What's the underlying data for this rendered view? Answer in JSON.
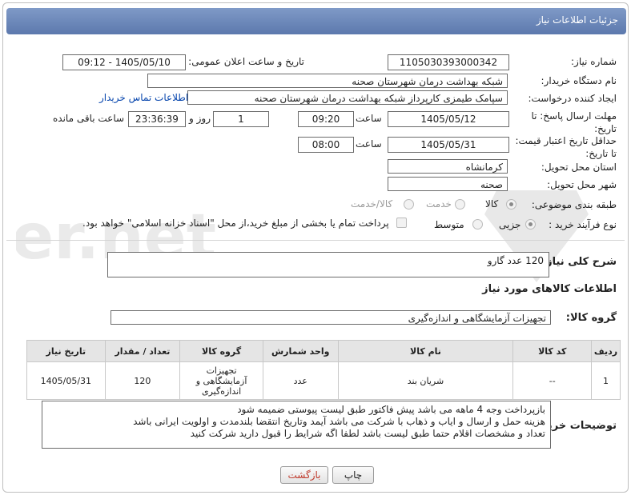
{
  "header": {
    "title": "جزئیات اطلاعات نیاز"
  },
  "form": {
    "need_number_label": "شماره نیاز:",
    "need_number": "1105030393000342",
    "announce_label": "تاریخ و ساعت اعلان عمومی:",
    "announce_value": "1405/05/10 - 09:12",
    "buyer_org_label": "نام دستگاه خریدار:",
    "buyer_org": "شبکه بهداشت درمان شهرستان صحنه",
    "requester_label": "ایجاد کننده درخواست:",
    "requester": "سپامک طیمزی کارپرداز شبکه بهداشت درمان شهرستان صحنه",
    "contact_link": "اطلاعات تماس خریدار",
    "reply_deadline_label": "مهلت ارسال پاسخ: تا تاریخ:",
    "reply_date": "1405/05/12",
    "time_label": "ساعت",
    "reply_time": "09:20",
    "day_label": "روز و",
    "days": "1",
    "remaining_time": "23:36:39",
    "remaining_label": "ساعت باقی مانده",
    "price_validity_label": "حداقل تاریخ اعتبار قیمت: تا تاریخ:",
    "validity_date": "1405/05/31",
    "validity_time": "08:00",
    "province_label": "استان محل تحویل:",
    "province": "کرمانشاه",
    "city_label": "شهر محل تحویل:",
    "city": "صحنه",
    "category_label": "طبقه بندی موضوعی:",
    "category_options": [
      "کالا",
      "خدمت",
      "کالا/خدمت"
    ],
    "process_label": "نوع فرآیند خرید :",
    "process_options": [
      "جزیی",
      "متوسط"
    ],
    "payment_note": "پرداخت تمام یا بخشی از مبلغ خرید،از محل \"اسناد خزانه اسلامی\" خواهد بود."
  },
  "description": {
    "label": "شرح کلی نیاز:",
    "value": "120 عدد گارو"
  },
  "goods": {
    "section_title": "اطلاعات کالاهای مورد نیاز",
    "group_label": "گروه کالا:",
    "group_value": "تجهیزات آزمایشگاهی و اندازه‌گیری",
    "table": {
      "headers": [
        "ردیف",
        "کد کالا",
        "نام کالا",
        "واحد شمارش",
        "گروه کالا",
        "تعداد / مقدار",
        "تاریخ نیاز"
      ],
      "rows": [
        {
          "index": "1",
          "code": "--",
          "name": "شریان بند",
          "unit": "عدد",
          "group": "تجهیزات آزمایشگاهی و اندازه‌گیری",
          "qty": "120",
          "date": "1405/05/31"
        }
      ]
    }
  },
  "buyer_notes": {
    "label": "توضیحات خریدار:",
    "lines": [
      "بازپرداخت وجه 4 ماهه می باشد پیش فاکتور طبق لیست پیوستی ضمیمه شود",
      "هزینه حمل و ارسال و ایاب و ذهاب با شرکت می باشد آیمد وتاریخ انتقضا بلندمدت و اولویت ایرانی باشد",
      "تعداد و مشخصات اقلام حتما طبق لیست باشد  لطفا اگه شرایط را قبول دارید شرکت کنید"
    ]
  },
  "buttons": {
    "print": "چاپ",
    "back": "بازگشت"
  },
  "watermark": {
    "text": "AriaTender.net"
  },
  "colors": {
    "header": "#6b86b8",
    "back_button_text": "#c0392b",
    "link": "#0645ad"
  }
}
